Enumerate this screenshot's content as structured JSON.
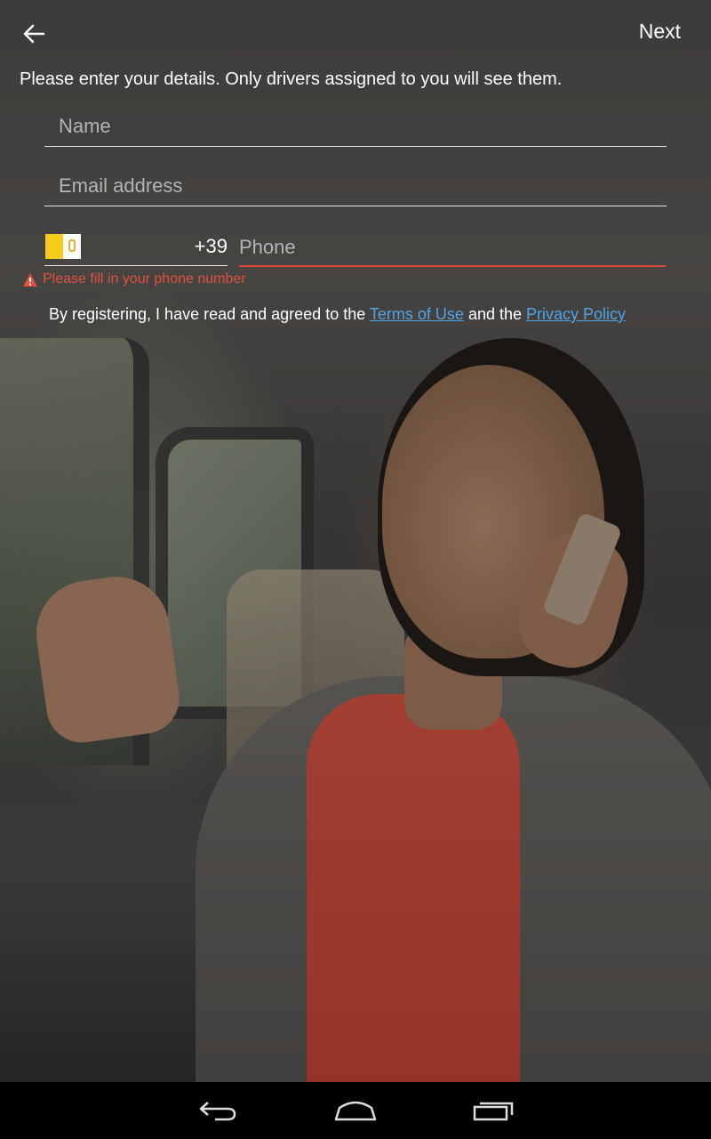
{
  "header": {
    "back_icon": "arrow-left-icon",
    "next_label": "Next"
  },
  "intro_text": "Please enter your details. Only drivers assigned to you will see them.",
  "form": {
    "name_placeholder": "Name",
    "name_value": "",
    "email_placeholder": "Email address",
    "email_value": "",
    "country_flag": "vatican-flag-icon",
    "dial_code": "+39",
    "phone_placeholder": "Phone",
    "phone_value": "",
    "error_text": "Please fill in your phone number"
  },
  "terms": {
    "prefix": "By registering, I have read and agreed to the ",
    "terms_link": "Terms of Use",
    "middle": " and the ",
    "privacy_link": "Privacy Policy"
  },
  "colors": {
    "error": "#e0503f",
    "link": "#4fa3e6",
    "text": "#ffffff"
  },
  "system_nav": {
    "back_icon": "nav-back-icon",
    "home_icon": "nav-home-icon",
    "recents_icon": "nav-recents-icon"
  }
}
